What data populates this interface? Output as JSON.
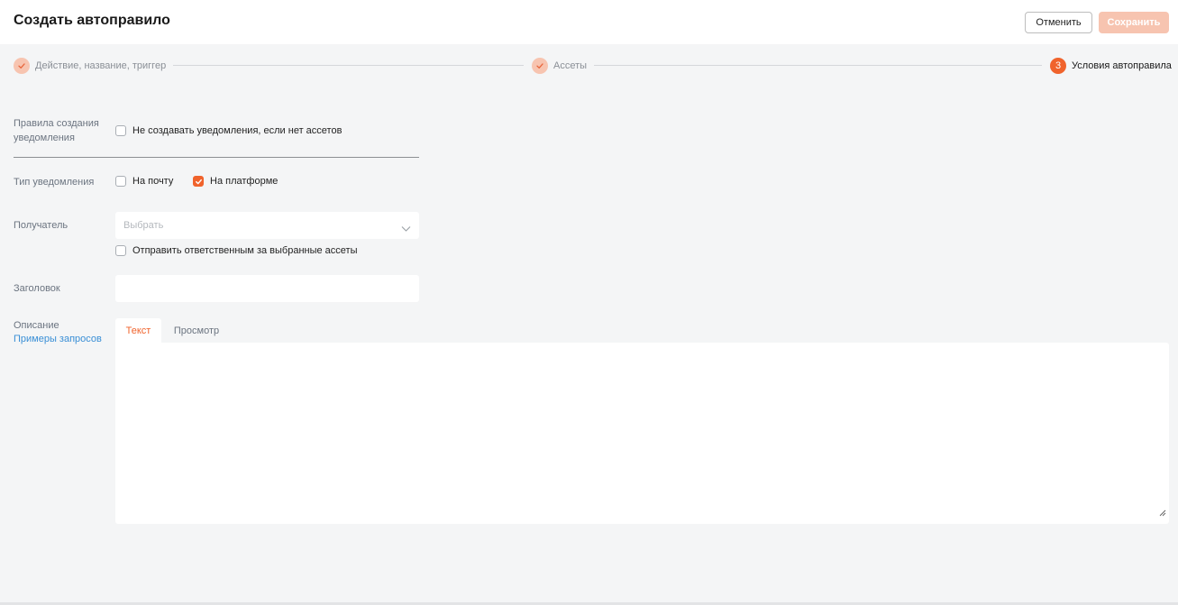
{
  "header": {
    "title": "Создать автоправило",
    "cancel_label": "Отменить",
    "save_label": "Сохранить"
  },
  "stepper": {
    "steps": [
      {
        "label": "Действие, название, триггер",
        "status": "done"
      },
      {
        "label": "Ассеты",
        "status": "done"
      },
      {
        "label": "Условия автоправила",
        "status": "active",
        "number": "3"
      }
    ]
  },
  "form": {
    "creation_rules": {
      "label": "Правила создания уведомления",
      "label_line1": "Правила создания",
      "label_line2": "уведомления",
      "checkbox_label": "Не создавать уведомления, если нет ассетов",
      "checked": false
    },
    "notification_type": {
      "label": "Тип уведомления",
      "options": [
        {
          "label": "На почту",
          "checked": false
        },
        {
          "label": "На платформе",
          "checked": true
        }
      ]
    },
    "recipient": {
      "label": "Получатель",
      "placeholder": "Выбрать",
      "checkbox_label": "Отправить ответственным за выбранные ассеты",
      "checked": false
    },
    "heading": {
      "label": "Заголовок",
      "value": ""
    },
    "description": {
      "label": "Описание",
      "examples_link": "Примеры запросов",
      "tabs": [
        {
          "label": "Текст",
          "active": true
        },
        {
          "label": "Просмотр",
          "active": false
        }
      ],
      "value": ""
    }
  },
  "colors": {
    "accent": "#f0632c",
    "accent_light": "#f7c4b0",
    "background": "#f4f5f6",
    "link": "#3a8fd6"
  }
}
